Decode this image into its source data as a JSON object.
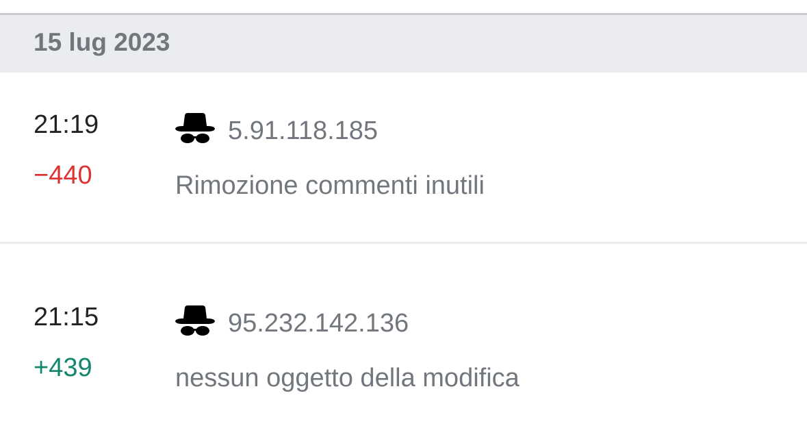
{
  "history": {
    "date_header": "15 lug 2023",
    "entries": [
      {
        "time": "21:19",
        "diff": "−440",
        "user": "5.91.118.185",
        "summary": "Rimozione commenti inutili",
        "user_icon": "anonymous-user-icon"
      },
      {
        "time": "21:15",
        "diff": "+439",
        "user": "95.232.142.136",
        "summary": "nessun oggetto della modifica",
        "user_icon": "anonymous-user-icon"
      }
    ]
  },
  "colors": {
    "negative_diff": "#dd3333",
    "positive_diff": "#14866d",
    "secondary_text": "#72777d",
    "header_background": "#eaecf0"
  }
}
